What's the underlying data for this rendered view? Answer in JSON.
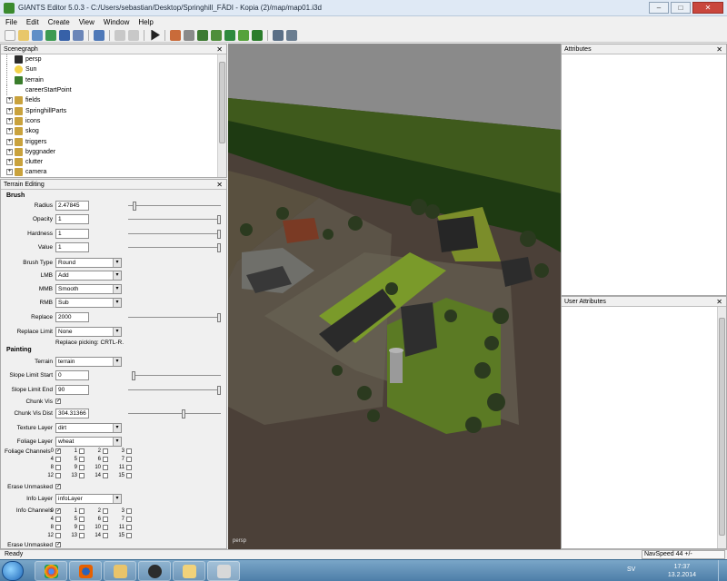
{
  "window": {
    "title": "GIANTS Editor 5.0.3 - C:/Users/sebastian/Desktop/Springhill_FÄDI - Kopia (2)/map/map01.i3d",
    "minimize": "–",
    "maximize": "□",
    "close": "✕"
  },
  "menu": [
    "File",
    "Edit",
    "Create",
    "View",
    "Window",
    "Help"
  ],
  "scenegraph": {
    "title": "Scenegraph",
    "close": "✕",
    "items": [
      {
        "label": "persp",
        "icon": "camera-icon",
        "expandable": false
      },
      {
        "label": "Sun",
        "icon": "light-bulb-icon",
        "expandable": false
      },
      {
        "label": "terrain",
        "icon": "terrain-icon",
        "expandable": false
      },
      {
        "label": "careerStartPoint",
        "icon": "",
        "expandable": false
      },
      {
        "label": "fields",
        "icon": "group-icon",
        "expandable": true
      },
      {
        "label": "SpringhillParts",
        "icon": "group-icon",
        "expandable": true
      },
      {
        "label": "icons",
        "icon": "group-icon",
        "expandable": true
      },
      {
        "label": "skog",
        "icon": "group-icon",
        "expandable": true
      },
      {
        "label": "triggers",
        "icon": "group-icon",
        "expandable": true
      },
      {
        "label": "byggnader",
        "icon": "group-icon",
        "expandable": true
      },
      {
        "label": "clutter",
        "icon": "group-icon",
        "expandable": true
      },
      {
        "label": "camera",
        "icon": "group-icon",
        "expandable": true
      }
    ]
  },
  "terrain_editing": {
    "title": "Terrain Editing",
    "close": "✕",
    "brush_heading": "Brush",
    "radius": {
      "label": "Radius",
      "value": "2.47845"
    },
    "opacity": {
      "label": "Opacity",
      "value": "1"
    },
    "hardness": {
      "label": "Hardness",
      "value": "1"
    },
    "value": {
      "label": "Value",
      "value": "1"
    },
    "brush_type": {
      "label": "Brush Type",
      "value": "Round"
    },
    "lmb": {
      "label": "LMB",
      "value": "Add"
    },
    "mmb": {
      "label": "MMB",
      "value": "Smooth"
    },
    "rmb": {
      "label": "RMB",
      "value": "Sub"
    },
    "replace": {
      "label": "Replace",
      "value": "2000"
    },
    "replace_limit": {
      "label": "Replace Limit",
      "value": "None"
    },
    "replace_hint": "Replace picking: CRTL-R.",
    "painting_heading": "Painting",
    "terrain": {
      "label": "Terrain",
      "value": "terrain"
    },
    "slope_start": {
      "label": "Slope Limit Start",
      "value": "0"
    },
    "slope_end": {
      "label": "Slope Limit End",
      "value": "90"
    },
    "chunk_vis": {
      "label": "Chunk Vis",
      "checked": true
    },
    "chunk_vis_dist": {
      "label": "Chunk Vis Dist",
      "value": "304.31366"
    },
    "texture_layer": {
      "label": "Texture Layer",
      "value": "dirt"
    },
    "foliage_layer": {
      "label": "Foliage Layer",
      "value": "wheat"
    },
    "foliage_channels": {
      "label": "Foliage Channels",
      "checked": [
        0
      ]
    },
    "erase_unmasked_1": {
      "label": "Erase Unmasked",
      "checked": true
    },
    "info_layer": {
      "label": "Info Layer",
      "value": "infoLayer"
    },
    "info_channels": {
      "label": "Info Channels",
      "checked": [
        0
      ]
    },
    "erase_unmasked_2": {
      "label": "Erase Unmasked",
      "checked": true
    },
    "channel_numbers": [
      "0",
      "1",
      "2",
      "3",
      "4",
      "5",
      "6",
      "7",
      "8",
      "9",
      "10",
      "11",
      "12",
      "13",
      "14",
      "15"
    ],
    "check_mark": "✓",
    "dropdown_arrow": "▾"
  },
  "sliders": {
    "radius": 0.05,
    "opacity": 1.0,
    "hardness": 1.0,
    "value": 1.0,
    "replace": 1.0,
    "slope_start": 0.0,
    "slope_end": 1.0,
    "chunk_vis_dist": 0.6
  },
  "viewport": {
    "camera_label": "persp"
  },
  "attributes": {
    "title": "Attributes",
    "close": "✕"
  },
  "user_attributes": {
    "title": "User Attributes",
    "close": "✕"
  },
  "status": {
    "text": "Ready",
    "navspeed": "NavSpeed 44 +/-"
  },
  "taskbar": {
    "apps": [
      "chrome-icon",
      "firefox-icon",
      "explorer-icon",
      "spotify-icon",
      "folder-icon",
      "giants-editor-icon"
    ],
    "lang": "SV",
    "time": "17:37",
    "date": "13.2.2014"
  }
}
